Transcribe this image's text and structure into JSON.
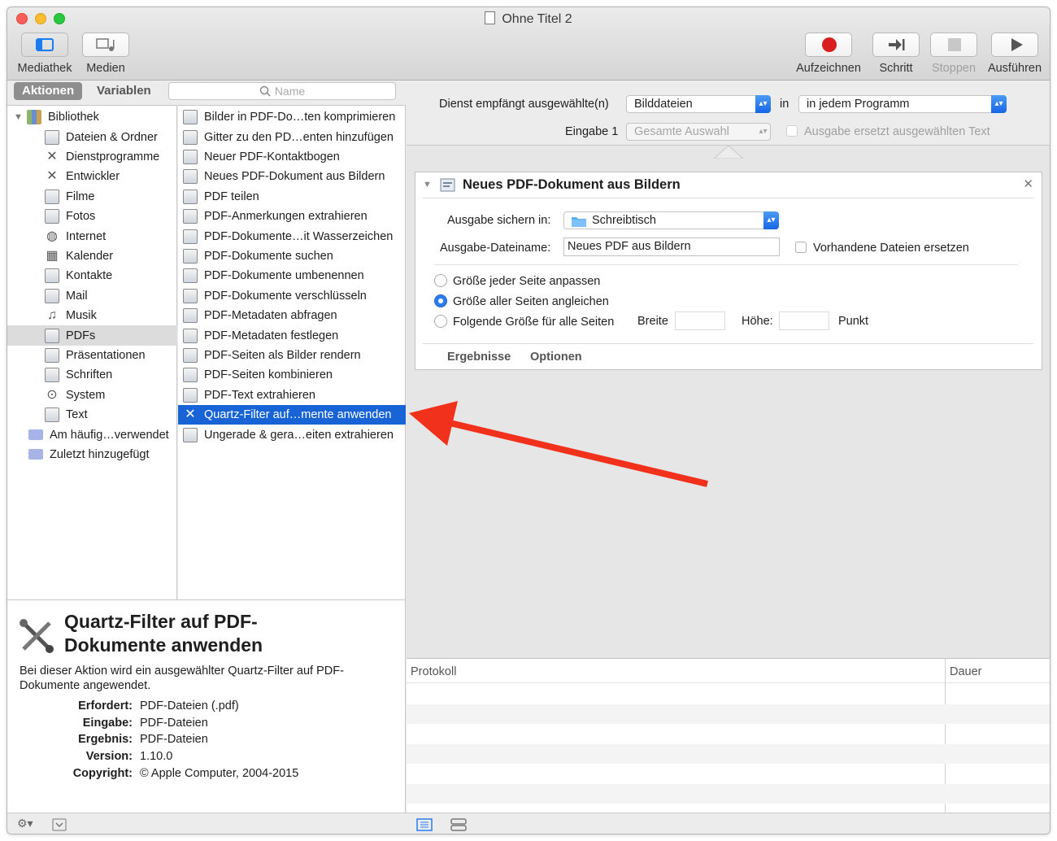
{
  "window": {
    "title": "Ohne Titel 2"
  },
  "toolbar": {
    "library_label": "Mediathek",
    "media_label": "Medien",
    "record_label": "Aufzeichnen",
    "step_label": "Schritt",
    "stop_label": "Stoppen",
    "run_label": "Ausführen"
  },
  "left": {
    "tab_actions": "Aktionen",
    "tab_variables": "Variablen",
    "search_placeholder": "Name"
  },
  "library": {
    "root": "Bibliothek",
    "items": [
      "Dateien & Ordner",
      "Dienstprogramme",
      "Entwickler",
      "Filme",
      "Fotos",
      "Internet",
      "Kalender",
      "Kontakte",
      "Mail",
      "Musik",
      "PDFs",
      "Präsentationen",
      "Schriften",
      "System",
      "Text"
    ],
    "icons": [
      "finder-icon",
      "tools-icon",
      "tools-icon",
      "quicktime-icon",
      "photo-icon",
      "globe-icon",
      "calendar-icon",
      "contacts-icon",
      "mail-icon",
      "music-icon",
      "pdf-icon",
      "keynote-icon",
      "font-icon",
      "system-icon",
      "text-icon"
    ],
    "selected": "PDFs",
    "smart": [
      "Am häufig…verwendet",
      "Zuletzt hinzugefügt"
    ]
  },
  "actions": {
    "items": [
      "Bilder in PDF-Do…ten komprimieren",
      "Gitter zu den PD…enten hinzufügen",
      "Neuer PDF-Kontaktbogen",
      "Neues PDF-Dokument aus Bildern",
      "PDF teilen",
      "PDF-Anmerkungen extrahieren",
      "PDF-Dokumente…it Wasserzeichen",
      "PDF-Dokumente suchen",
      "PDF-Dokumente umbenennen",
      "PDF-Dokumente verschlüsseln",
      "PDF-Metadaten abfragen",
      "PDF-Metadaten festlegen",
      "PDF-Seiten als Bilder rendern",
      "PDF-Seiten kombinieren",
      "PDF-Text extrahieren",
      "Quartz-Filter auf…mente anwenden",
      "Ungerade & gera…eiten extrahieren"
    ],
    "selected": "Quartz-Filter auf…mente anwenden"
  },
  "description": {
    "title_line1": "Quartz-Filter auf PDF-",
    "title_line2": "Dokumente anwenden",
    "text": "Bei dieser Aktion wird ein ausgewählter Quartz-Filter auf PDF-Dokumente angewendet.",
    "fields": [
      {
        "label": "Erfordert:",
        "value": "PDF-Dateien (.pdf)"
      },
      {
        "label": "Eingabe:",
        "value": "PDF-Dateien"
      },
      {
        "label": "Ergebnis:",
        "value": "PDF-Dateien"
      },
      {
        "label": "Version:",
        "value": "1.10.0"
      },
      {
        "label": "Copyright:",
        "value": "© Apple Computer, 2004-2015"
      }
    ]
  },
  "service": {
    "receives_label": "Dienst empfängt ausgewählte(n)",
    "receives_value": "Bilddateien",
    "in_label": "in",
    "in_value": "in jedem Programm",
    "input_label": "Eingabe 1",
    "input_value": "Gesamte Auswahl",
    "replace_label": "Ausgabe ersetzt ausgewählten Text"
  },
  "action_card": {
    "title": "Neues PDF-Dokument aus Bildern",
    "save_label": "Ausgabe sichern in:",
    "save_value": "Schreibtisch",
    "filename_label": "Ausgabe-Dateiname:",
    "filename_value": "Neues PDF aus Bildern",
    "replace_existing_label": "Vorhandene Dateien ersetzen",
    "radio1": "Größe jeder Seite anpassen",
    "radio2": "Größe aller Seiten angleichen",
    "radio3": "Folgende Größe für alle Seiten",
    "width_label": "Breite",
    "height_label": "Höhe:",
    "unit_label": "Punkt",
    "results_label": "Ergebnisse",
    "options_label": "Optionen"
  },
  "log": {
    "col_log": "Protokoll",
    "col_duration": "Dauer"
  },
  "colors": {
    "selection": "#1863d6",
    "record": "#d81e1e",
    "annotation_arrow": "#f2311c"
  }
}
